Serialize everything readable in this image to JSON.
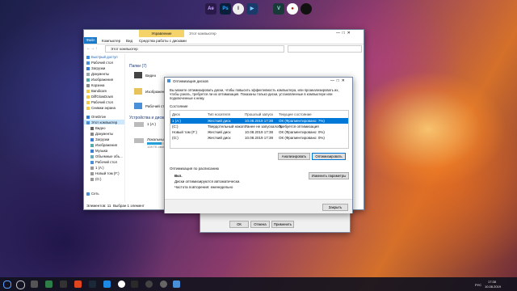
{
  "dock_icons": [
    {
      "label": "Ae",
      "color": "#2a1a4a",
      "fg": "#c9a8ff"
    },
    {
      "label": "Ps",
      "color": "#0a1f3a",
      "fg": "#31a8ff"
    },
    {
      "label": "I",
      "color": "#eeeeee",
      "fg": "#222222"
    },
    {
      "label": "▶",
      "color": "#1a3a6a",
      "fg": "#7ec8ff"
    },
    {
      "label": "V",
      "color": "#1a3a3a",
      "fg": "#8fe0d0"
    },
    {
      "label": "●",
      "color": "#ffffff",
      "fg": "#cc0000"
    },
    {
      "label": "",
      "color": "#111111",
      "fg": "#111111"
    }
  ],
  "explorer": {
    "ribbon_tab_top": "Управление",
    "title": "Этот компьютер",
    "ribbon_tabs": [
      "Файл",
      "Компьютер",
      "Вид",
      "Средства работы с дисками"
    ],
    "address": "Этот компьютер",
    "quick_access": [
      "Быстрый доступ",
      "Рабочий стол",
      "Загрузки",
      "Документы",
      "Изображения",
      "Корзина",
      "Bandicam",
      "DiffGlowDown",
      "Рабочий стол",
      "Снимки экрана"
    ],
    "nav_items": [
      "OneDrive",
      "Этот компьютер",
      "Видео",
      "Документы",
      "Загрузки",
      "Изображения",
      "Музыка",
      "Объемные объ...",
      "Рабочий стол",
      "1 (A:)",
      "Новый том (F:)",
      "(G:)",
      "Сеть"
    ],
    "folders_header": "Папки (7)",
    "folders": [
      "Видео",
      "Изображения",
      "Рабочий стол"
    ],
    "devices_header": "Устройства и диски (4)",
    "drives": [
      {
        "label": "1 (A:)",
        "size": "..."
      },
      {
        "label": "Локальный диск",
        "size": "128 ГБ свободно из 223 ГБ"
      }
    ],
    "status_count": "Элементов: 11",
    "status_selected": "Выбран 1 элемент"
  },
  "dialog": {
    "title": "Оптимизация дисков",
    "description": "Вы можете оптимизировать диски, чтобы повысить эффективность компьютера, или проанализировать их, чтобы узнать, требуется ли их оптимизация. Показаны только диски, установленные в компьютере или подключенные к нему.",
    "status_label": "Состояние",
    "columns": [
      "Диск",
      "Тип носителя",
      "Прошлый запуск",
      "Текущее состояние"
    ],
    "rows": [
      {
        "disk": "1 (A:)",
        "media": "Жесткий диск",
        "last": "10.08.2019 17:38",
        "state": "ОК (Фрагментировано: 7%)",
        "selected": true
      },
      {
        "disk": "(C:)",
        "media": "Твердотельный накоп...",
        "last": "Ранее не запускалось",
        "state": "Требуется оптимизация",
        "selected": false
      },
      {
        "disk": "Новый том (F:)",
        "media": "Жесткий диск",
        "last": "10.08.2019 17:38",
        "state": "ОК (Фрагментировано: 0%)",
        "selected": false
      },
      {
        "disk": "(G:)",
        "media": "Жесткий диск",
        "last": "10.08.2019 17:38",
        "state": "ОК (Фрагментировано: 0%)",
        "selected": false
      }
    ],
    "analyze_btn": "Анализировать",
    "optimize_btn": "Оптимизировать",
    "schedule_header": "Оптимизация по расписанию",
    "schedule_on": "Вкл.",
    "schedule_line1": "Диски оптимизируются автоматически.",
    "schedule_line2": "Частота повторения: еженедельно",
    "change_params_btn": "Изменить параметры",
    "close_btn": "Закрыть"
  },
  "props_dialog": {
    "ok": "ОК",
    "cancel": "Отмена",
    "apply": "Применить"
  },
  "taskbar": {
    "lang": "РУС",
    "time": "17:38",
    "date": "10.08.2019"
  }
}
